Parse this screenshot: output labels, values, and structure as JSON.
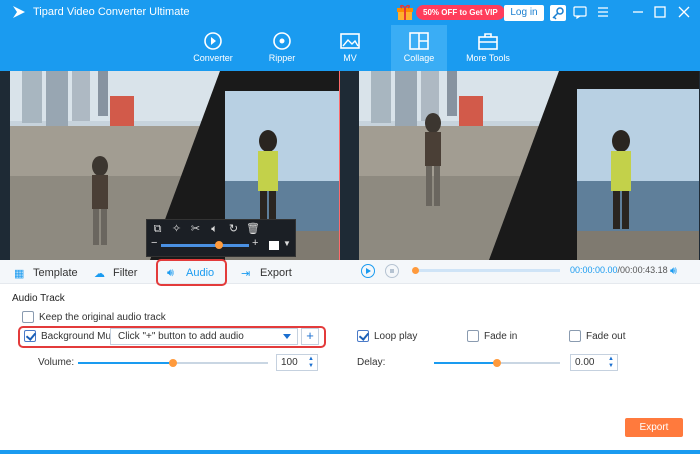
{
  "app": {
    "title": "Tipard Video Converter Ultimate",
    "promo": "50% OFF to Get VIP",
    "login": "Log in"
  },
  "nav": [
    {
      "label": "Converter",
      "icon": "converter-icon"
    },
    {
      "label": "Ripper",
      "icon": "ripper-icon"
    },
    {
      "label": "MV",
      "icon": "mv-icon"
    },
    {
      "label": "Collage",
      "icon": "collage-icon",
      "active": true
    },
    {
      "label": "More Tools",
      "icon": "toolbox-icon"
    }
  ],
  "tabs": [
    {
      "label": "Template",
      "icon": "template-icon"
    },
    {
      "label": "Filter",
      "icon": "filter-icon"
    },
    {
      "label": "Audio",
      "icon": "audio-icon",
      "active": true
    },
    {
      "label": "Export",
      "icon": "export-icon"
    }
  ],
  "player": {
    "current_time": "00:00:00.00",
    "total_time": "/00:00:43.18",
    "progress": 0
  },
  "audio": {
    "section_title": "Audio Track",
    "keep_original_label": "Keep the original audio track",
    "keep_original_checked": false,
    "bgm_label": "Background Music",
    "bgm_checked": true,
    "bgm_select_value": "Click \"+\" button to add audio",
    "add_button": "+",
    "volume_label": "Volume:",
    "volume_value": "100",
    "volume_level": 0.5,
    "delay_label": "Delay:",
    "delay_value": "0.00",
    "delay_level": 0.5,
    "loop_play_label": "Loop play",
    "loop_play_checked": true,
    "fade_in_label": "Fade in",
    "fade_in_checked": false,
    "fade_out_label": "Fade out",
    "fade_out_checked": false
  },
  "export_button": "Export",
  "colors": {
    "accent": "#1a9bf0",
    "export": "#ff7a3d",
    "highlight": "#e33b3b",
    "slider_knob": "#ff9a3c"
  }
}
